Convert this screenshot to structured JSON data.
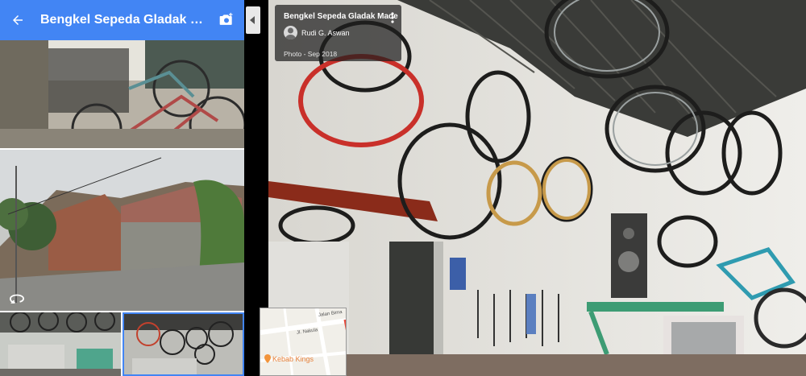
{
  "topbar": {
    "title": "Bengkel Sepeda Gladak Made",
    "back_icon": "arrow-left-icon",
    "camera_icon": "add-photo-icon",
    "color": "#4285f4"
  },
  "photo_card": {
    "title": "Bengkel Sepeda Gladak Made",
    "author": "Rudi G. Aswan",
    "date": "Photo - Sep 2018"
  },
  "minimap": {
    "place_label": "Kebab Kings",
    "road_label_1": "Jalan Bima",
    "road_label_2": "Jl. Nakula"
  }
}
